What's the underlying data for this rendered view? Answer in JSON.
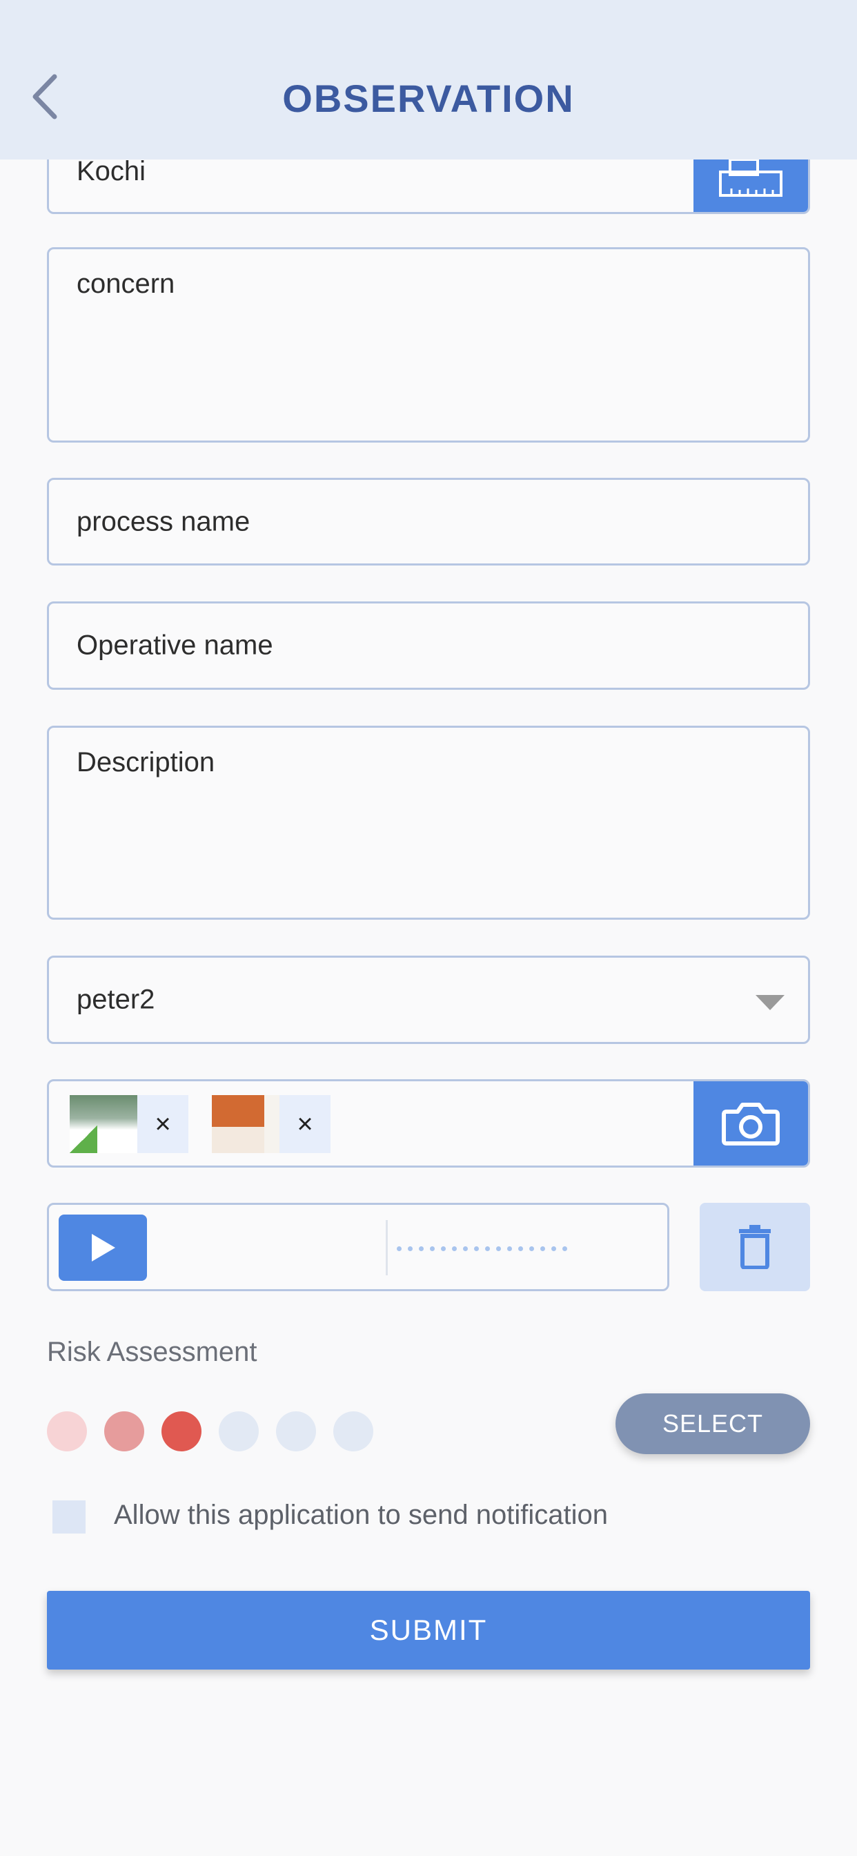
{
  "header": {
    "title": "OBSERVATION",
    "back_icon": "chevron-left-icon"
  },
  "form": {
    "location": {
      "value": "Kochi",
      "icon": "map-ruler-icon"
    },
    "concern": {
      "placeholder": "concern"
    },
    "process_name": {
      "placeholder": "process name"
    },
    "operative_name": {
      "placeholder": "Operative name"
    },
    "description": {
      "placeholder": "Description"
    },
    "assignee": {
      "value": "peter2",
      "icon": "caret-down-icon"
    },
    "attachments": {
      "images": [
        {
          "remove_label": "×"
        },
        {
          "remove_label": "×"
        }
      ],
      "camera_icon": "camera-icon"
    },
    "audio": {
      "play_icon": "play-icon",
      "delete_icon": "trash-icon"
    }
  },
  "risk_assessment": {
    "label": "Risk Assessment",
    "level": 3,
    "max_level": 6,
    "colors": [
      "#f7d3d5",
      "#e69c9c",
      "#e05951",
      "#e2e9f4",
      "#e2e9f4",
      "#e2e9f4"
    ],
    "select_label": "SELECT"
  },
  "notification": {
    "label": "Allow this application to send notification",
    "checked": false
  },
  "submit_label": "SUBMIT",
  "colors": {
    "accent": "#4f87e2",
    "header_bg": "#e4ebf6",
    "title": "#3c5aa0",
    "border": "#b6c6e2"
  }
}
